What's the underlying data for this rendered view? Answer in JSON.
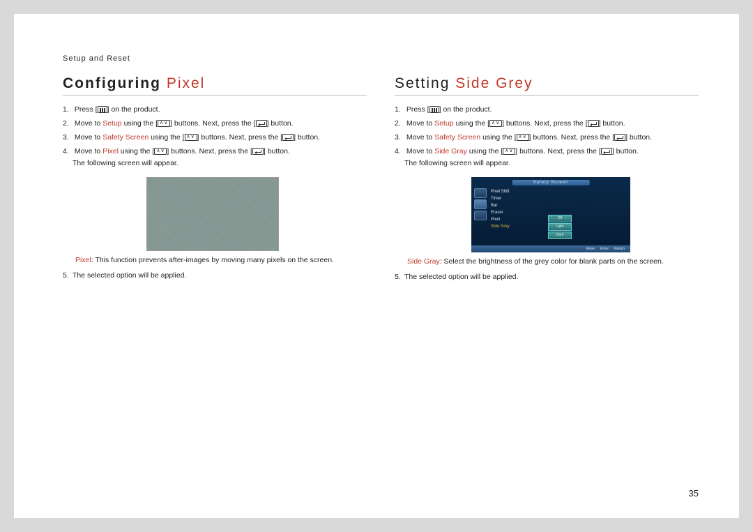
{
  "header": "Setup and Reset",
  "page_number": "35",
  "left": {
    "title_bold": "Configuring",
    "title_accent": "Pixel",
    "step1_a": "Press [",
    "step1_b": "] on the product.",
    "step2_a": "Move to ",
    "step2_link": "Setup",
    "step2_b": " using the [",
    "step2_c": "] buttons. Next, press the [",
    "step2_d": "] button.",
    "step3_a": "Move to ",
    "step3_link": "Safety Screen",
    "step3_b": " using the [",
    "step3_c": "] buttons. Next, press the [",
    "step3_d": "] button.",
    "step4_a": "Move to ",
    "step4_link": "Pixel",
    "step4_b": " using the [",
    "step4_c": "] buttons. Next, press the [",
    "step4_d": "] button.",
    "step4_e": "The following screen will appear.",
    "note_label": "Pixel",
    "note_text": ": This function prevents after-images by moving many pixels on the screen.",
    "step5": "The selected option will be applied."
  },
  "right": {
    "title_bold": "Setting",
    "title_accent": "Side Grey",
    "step1_a": "Press [",
    "step1_b": "] on the product.",
    "step2_a": "Move to ",
    "step2_link": "Setup",
    "step2_b": " using the [",
    "step2_c": "] buttons. Next, press the [",
    "step2_d": "] button.",
    "step3_a": "Move to ",
    "step3_link": "Safety Screen",
    "step3_b": " using the [",
    "step3_c": "] buttons. Next, press the [",
    "step3_d": "] button.",
    "step4_a": "Move to ",
    "step4_link": "Side Gray",
    "step4_b": " using the [",
    "step4_c": "] buttons. Next, press the [",
    "step4_d": "] button.",
    "step4_e": "The following screen will appear.",
    "note_label": "Side Gray",
    "note_text": ": Select the brightness of the grey color for blank parts on the screen.",
    "step5": "The selected option will be applied."
  },
  "osd": {
    "title": "Safety Screen",
    "items": [
      "Pixel Shift",
      "Timer",
      "Bar",
      "Eraser",
      "Pixel",
      "Side Gray"
    ],
    "options": [
      "Off",
      "Light",
      "Dark"
    ],
    "footer": [
      "Move",
      "Enter",
      "Return"
    ]
  }
}
